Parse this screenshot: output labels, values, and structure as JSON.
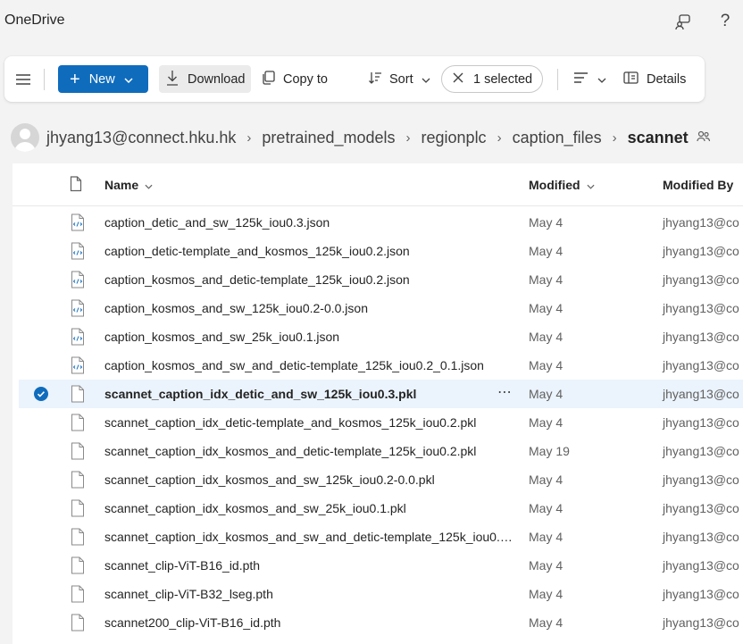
{
  "app": {
    "title": "OneDrive"
  },
  "toolbar": {
    "new_label": "New",
    "download_label": "Download",
    "copy_label": "Copy to",
    "sort_label": "Sort",
    "selected_label": "1 selected",
    "details_label": "Details"
  },
  "breadcrumb": {
    "items": [
      "jhyang13@connect.hku.hk",
      "pretrained_models",
      "regionplc",
      "caption_files"
    ],
    "current": "scannet"
  },
  "table": {
    "headers": {
      "name": "Name",
      "modified": "Modified",
      "modified_by": "Modified By"
    },
    "rows": [
      {
        "name": "caption_detic_and_sw_125k_iou0.3.json",
        "modified": "May 4",
        "modified_by": "jhyang13@co",
        "icon": "json-file-icon"
      },
      {
        "name": "caption_detic-template_and_kosmos_125k_iou0.2.json",
        "modified": "May 4",
        "modified_by": "jhyang13@co",
        "icon": "json-file-icon"
      },
      {
        "name": "caption_kosmos_and_detic-template_125k_iou0.2.json",
        "modified": "May 4",
        "modified_by": "jhyang13@co",
        "icon": "json-file-icon"
      },
      {
        "name": "caption_kosmos_and_sw_125k_iou0.2-0.0.json",
        "modified": "May 4",
        "modified_by": "jhyang13@co",
        "icon": "json-file-icon"
      },
      {
        "name": "caption_kosmos_and_sw_25k_iou0.1.json",
        "modified": "May 4",
        "modified_by": "jhyang13@co",
        "icon": "json-file-icon"
      },
      {
        "name": "caption_kosmos_and_sw_and_detic-template_125k_iou0.2_0.1.json",
        "modified": "May 4",
        "modified_by": "jhyang13@co",
        "icon": "json-file-icon"
      },
      {
        "name": "scannet_caption_idx_detic_and_sw_125k_iou0.3.pkl",
        "modified": "May 4",
        "modified_by": "jhyang13@co",
        "icon": "file-icon",
        "selected": true
      },
      {
        "name": "scannet_caption_idx_detic-template_and_kosmos_125k_iou0.2.pkl",
        "modified": "May 4",
        "modified_by": "jhyang13@co",
        "icon": "file-icon"
      },
      {
        "name": "scannet_caption_idx_kosmos_and_detic-template_125k_iou0.2.pkl",
        "modified": "May 19",
        "modified_by": "jhyang13@co",
        "icon": "file-icon"
      },
      {
        "name": "scannet_caption_idx_kosmos_and_sw_125k_iou0.2-0.0.pkl",
        "modified": "May 4",
        "modified_by": "jhyang13@co",
        "icon": "file-icon"
      },
      {
        "name": "scannet_caption_idx_kosmos_and_sw_25k_iou0.1.pkl",
        "modified": "May 4",
        "modified_by": "jhyang13@co",
        "icon": "file-icon"
      },
      {
        "name": "scannet_caption_idx_kosmos_and_sw_and_detic-template_125k_iou0.2_0...",
        "modified": "May 4",
        "modified_by": "jhyang13@co",
        "icon": "file-icon"
      },
      {
        "name": "scannet_clip-ViT-B16_id.pth",
        "modified": "May 4",
        "modified_by": "jhyang13@co",
        "icon": "file-icon"
      },
      {
        "name": "scannet_clip-ViT-B32_lseg.pth",
        "modified": "May 4",
        "modified_by": "jhyang13@co",
        "icon": "file-icon"
      },
      {
        "name": "scannet200_clip-ViT-B16_id.pth",
        "modified": "May 4",
        "modified_by": "jhyang13@co",
        "icon": "file-icon"
      }
    ]
  },
  "colors": {
    "accent": "#0f6cbd",
    "selected_row": "#ebf3fc"
  }
}
